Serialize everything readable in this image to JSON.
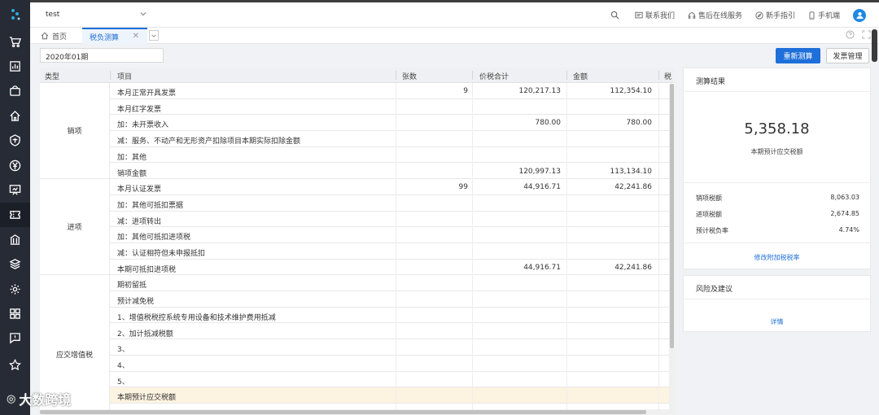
{
  "header": {
    "company": "test",
    "actions": [
      "联系我们",
      "售后在线服务",
      "新手指引",
      "手机端"
    ]
  },
  "tabs": {
    "home": "首页",
    "active": "税负测算"
  },
  "toolbar": {
    "period": "2020年01期",
    "recalc": "重新测算",
    "invoice_mgmt": "发票管理"
  },
  "table": {
    "headers": [
      "类型",
      "项目",
      "张数",
      "价税合计",
      "金额",
      "税"
    ],
    "groups": [
      "销项",
      "进项",
      "应交增值税"
    ],
    "rows": [
      {
        "item": "本月正常开具发票",
        "count": "9",
        "total": "120,217.13",
        "amount": "112,354.10"
      },
      {
        "item": "本月红字发票",
        "count": "",
        "total": "",
        "amount": ""
      },
      {
        "item": "加：未开票收入",
        "count": "",
        "total": "780.00",
        "amount": "780.00"
      },
      {
        "item": "减：服务、不动产和无形资产扣除项目本期实际扣除金额",
        "count": "",
        "total": "",
        "amount": ""
      },
      {
        "item": "加：其他",
        "count": "",
        "total": "",
        "amount": ""
      },
      {
        "item": "销项金额",
        "count": "",
        "total": "120,997.13",
        "amount": "113,134.10"
      },
      {
        "item": "本月认证发票",
        "count": "99",
        "total": "44,916.71",
        "amount": "42,241.86"
      },
      {
        "item": "加：其他可抵扣票据",
        "count": "",
        "total": "",
        "amount": ""
      },
      {
        "item": "减：进项转出",
        "count": "",
        "total": "",
        "amount": ""
      },
      {
        "item": "加：其他可抵扣进项税",
        "count": "",
        "total": "",
        "amount": ""
      },
      {
        "item": "减：认证相符但未申报抵扣",
        "count": "",
        "total": "",
        "amount": ""
      },
      {
        "item": "本期可抵扣进项税",
        "count": "",
        "total": "44,916.71",
        "amount": "42,241.86"
      },
      {
        "item": "期初留抵",
        "count": "",
        "total": "",
        "amount": ""
      },
      {
        "item": "预计减免税",
        "count": "",
        "total": "",
        "amount": ""
      },
      {
        "item": "1、增值税税控系统专用设备和技术维护费用抵减",
        "count": "",
        "total": "",
        "amount": ""
      },
      {
        "item": "2、加计抵减税额",
        "count": "",
        "total": "",
        "amount": ""
      },
      {
        "item": "3、",
        "count": "",
        "total": "",
        "amount": ""
      },
      {
        "item": "4、",
        "count": "",
        "total": "",
        "amount": ""
      },
      {
        "item": "5、",
        "count": "",
        "total": "",
        "amount": ""
      },
      {
        "item": "本期预计应交税额",
        "count": "",
        "total": "",
        "amount": ""
      }
    ]
  },
  "result": {
    "title": "测算结果",
    "value": "5,358.18",
    "value_label": "本期预计应交税额",
    "metrics": [
      {
        "label": "销项税额",
        "value": "8,063.03"
      },
      {
        "label": "进项税额",
        "value": "2,674.85"
      },
      {
        "label": "预计税负率",
        "value": "4.74%"
      }
    ],
    "link": "修改附加税税率"
  },
  "risk": {
    "title": "风险及建议",
    "link": "详情"
  },
  "watermark": "大数跨境",
  "colors": {
    "primary": "#1e6fd9",
    "sidebar": "#262b35",
    "highlight": "#fdf3e1"
  }
}
